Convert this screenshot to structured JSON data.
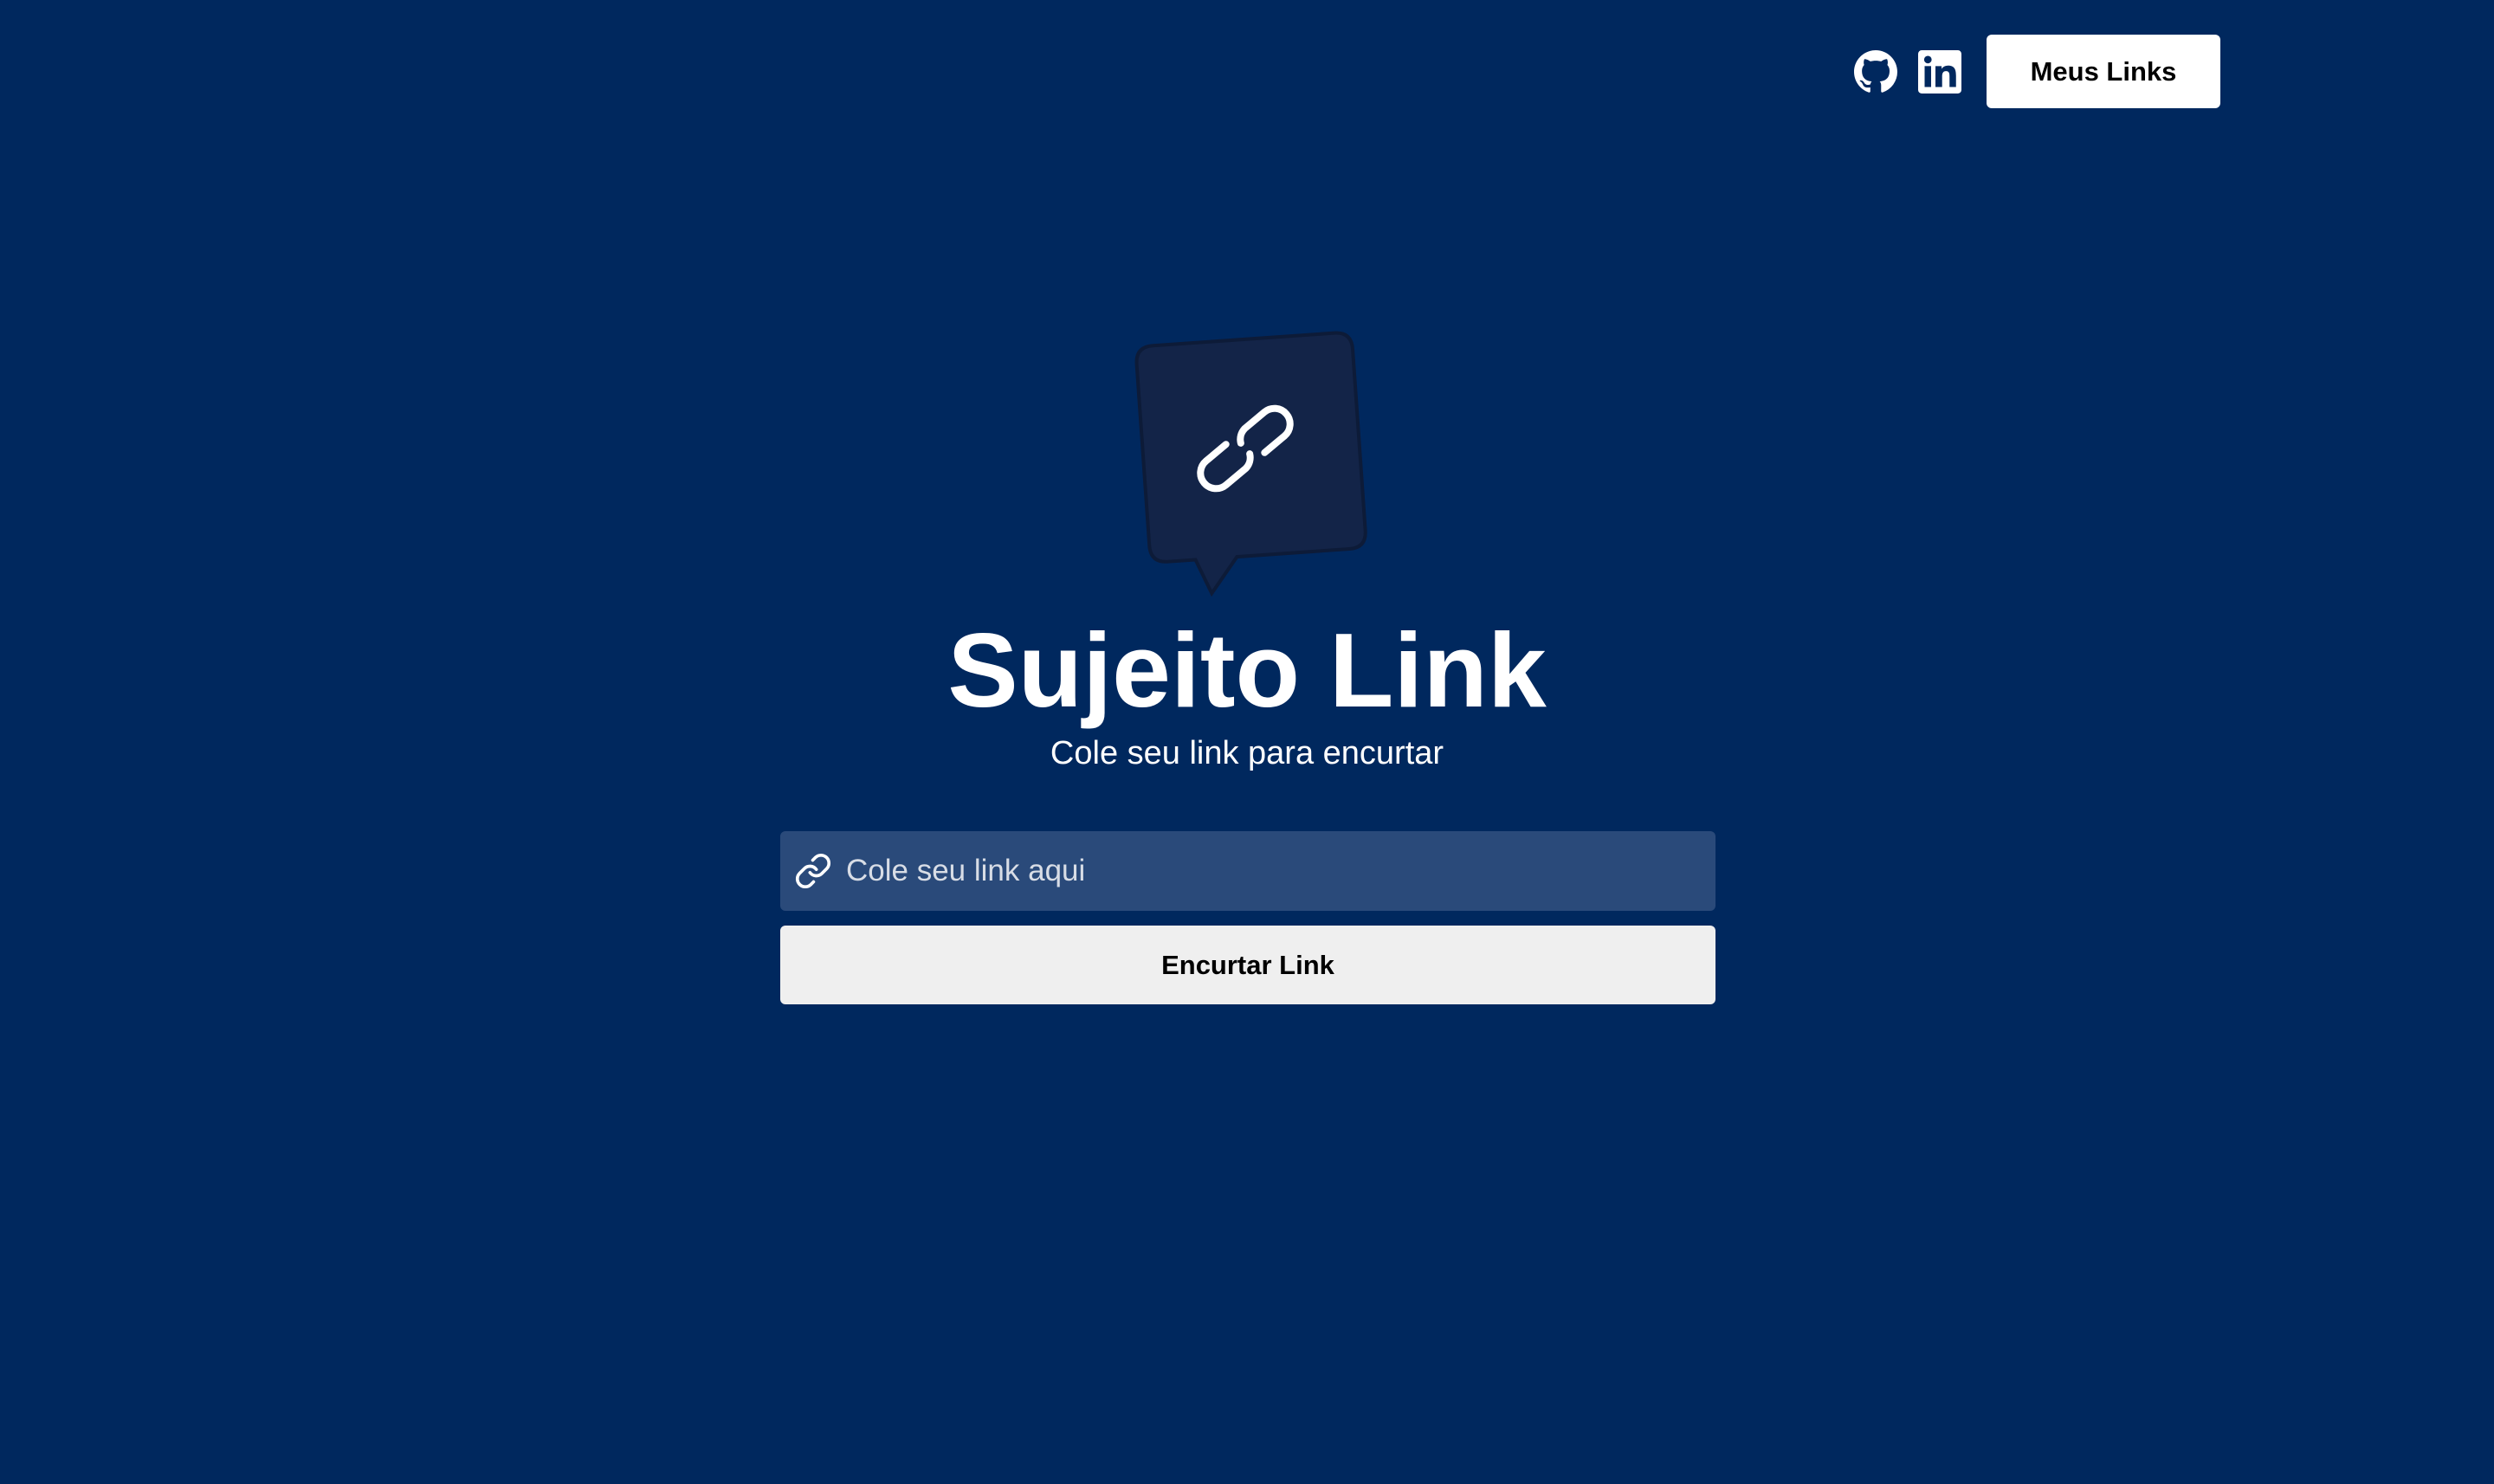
{
  "header": {
    "github_icon": "github-icon",
    "linkedin_icon": "linkedin-icon",
    "my_links_label": "Meus Links"
  },
  "hero": {
    "logo_icon": "chain-link-speech-bubble-icon",
    "title": "Sujeito Link",
    "subtitle": "Cole seu link para encurtar"
  },
  "form": {
    "input_icon": "link-icon",
    "input_value": "",
    "input_placeholder": "Cole seu link aqui",
    "submit_label": "Encurtar Link"
  },
  "colors": {
    "background": "#00285e",
    "logo_bubble": "#132448",
    "input_background": "#2a4a7a",
    "button_background": "#efefef",
    "nav_button_background": "#ffffff",
    "text_primary": "#ffffff"
  }
}
